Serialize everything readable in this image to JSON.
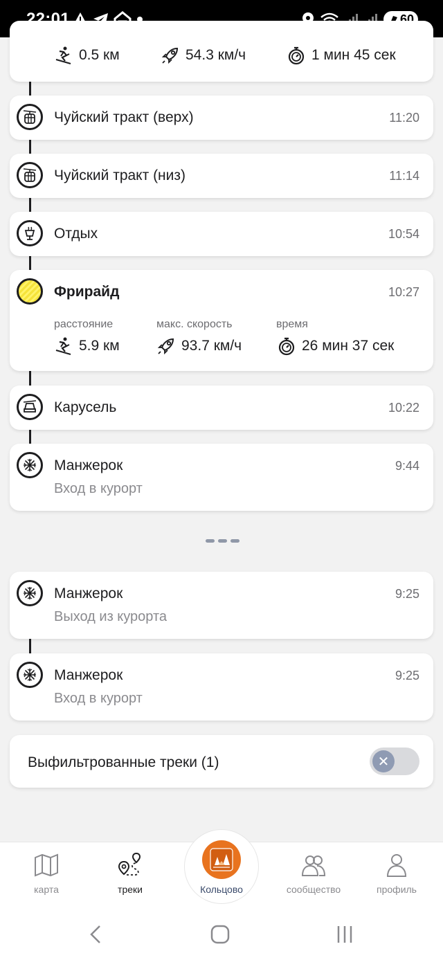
{
  "status_bar": {
    "time": "22:01",
    "battery": "60",
    "left_icons": [
      "warning-icon",
      "telegram-icon",
      "home-icon",
      "dot-icon"
    ],
    "right_icons": [
      "location-icon",
      "wifi-icon",
      "signal-icon",
      "signal-icon",
      "battery-icon"
    ]
  },
  "top_stats": {
    "distance": "0.5 км",
    "max_speed": "54.3 км/ч",
    "time": "1 мин 45 сек"
  },
  "events": [
    {
      "title": "Чуйский тракт (верх)",
      "time": "11:20",
      "icon": "gondola-icon"
    },
    {
      "title": "Чуйский тракт (низ)",
      "time": "11:14",
      "icon": "gondola-icon"
    },
    {
      "title": "Отдых",
      "time": "10:54",
      "icon": "mulled-drink-icon"
    }
  ],
  "freeride": {
    "title": "Фрирайд",
    "time": "10:27",
    "label_distance": "расстояние",
    "label_speed": "макс. скорость",
    "label_time": "время",
    "distance": "5.9 км",
    "max_speed": "93.7 км/ч",
    "duration": "26 мин 37 сек",
    "color": "#f5e33a"
  },
  "carousel": {
    "title": "Карусель",
    "time": "10:22",
    "icon": "chairlift-icon"
  },
  "resort_1": {
    "title": "Манжерок",
    "time": "9:44",
    "subtitle": "Вход в курорт"
  },
  "resort_2": {
    "title": "Манжерок",
    "time": "9:25",
    "subtitle": "Выход из курорта"
  },
  "resort_3": {
    "title": "Манжерок",
    "time": "9:25",
    "subtitle": "Вход в курорт"
  },
  "filter": {
    "label": "Выфильтрованные треки (1)",
    "enabled": false
  },
  "tabbar": {
    "map": "карта",
    "tracks": "треки",
    "center": "Кольцово",
    "community": "сообщество",
    "profile": "профиль",
    "center_color": "#e8731f"
  }
}
